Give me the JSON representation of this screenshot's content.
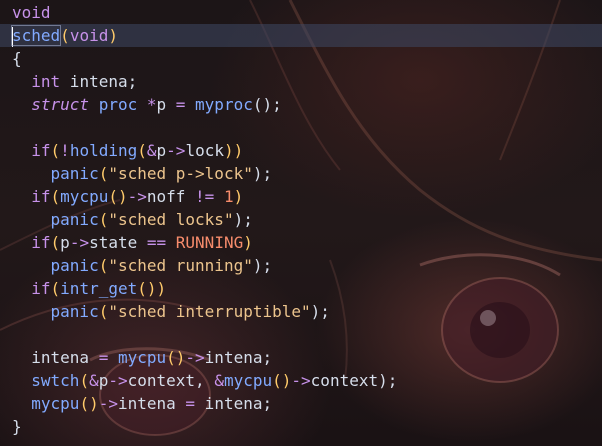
{
  "code": {
    "l1": {
      "t1": "void"
    },
    "l2": {
      "t1": "sched",
      "t2": "(",
      "t3": "void",
      "t4": ")"
    },
    "l3": {
      "t1": "{"
    },
    "l4": {
      "t1": "int",
      "t2": " intena;"
    },
    "l5": {
      "t1": "struct",
      "t2": " proc ",
      "t3": "*",
      "t4": "p ",
      "t5": "=",
      "t6": " myproc",
      "t7": "();"
    },
    "l7": {
      "t1": "if",
      "t2": "(",
      "t3": "!",
      "t4": "holding",
      "t5": "(",
      "t6": "&",
      "t7": "p",
      "t8": "->",
      "t9": "lock",
      "t10": "))"
    },
    "l8": {
      "t1": "panic",
      "t2": "(",
      "t3": "\"sched p->lock\"",
      "t4": ");"
    },
    "l9": {
      "t1": "if",
      "t2": "(",
      "t3": "mycpu",
      "t4": "()",
      "t5": "->",
      "t6": "noff ",
      "t7": "!=",
      "t8": " ",
      "t9": "1",
      "t10": ")"
    },
    "l10": {
      "t1": "panic",
      "t2": "(",
      "t3": "\"sched locks\"",
      "t4": ");"
    },
    "l11": {
      "t1": "if",
      "t2": "(",
      "t3": "p",
      "t4": "->",
      "t5": "state ",
      "t6": "==",
      "t7": " ",
      "t8": "RUNNING",
      "t9": ")"
    },
    "l12": {
      "t1": "panic",
      "t2": "(",
      "t3": "\"sched running\"",
      "t4": ");"
    },
    "l13": {
      "t1": "if",
      "t2": "(",
      "t3": "intr_get",
      "t4": "())"
    },
    "l14": {
      "t1": "panic",
      "t2": "(",
      "t3": "\"sched interruptible\"",
      "t4": ");"
    },
    "l16": {
      "t1": "intena ",
      "t2": "=",
      "t3": " mycpu",
      "t4": "()",
      "t5": "->",
      "t6": "intena;"
    },
    "l17": {
      "t1": "swtch",
      "t2": "(",
      "t3": "&",
      "t4": "p",
      "t5": "->",
      "t6": "context, ",
      "t7": "&",
      "t8": "mycpu",
      "t9": "()",
      "t10": "->",
      "t11": "context",
      "t12": ");"
    },
    "l18": {
      "t1": "mycpu",
      "t2": "()",
      "t3": "->",
      "t4": "intena ",
      "t5": "=",
      "t6": " intena;"
    },
    "l19": {
      "t1": "}"
    }
  },
  "colors": {
    "keyword": "#c792ea",
    "function": "#82aaff",
    "string": "#ecc48d",
    "number": "#f78c6c",
    "text": "#d6deeb",
    "current_line": "#3e4864"
  }
}
